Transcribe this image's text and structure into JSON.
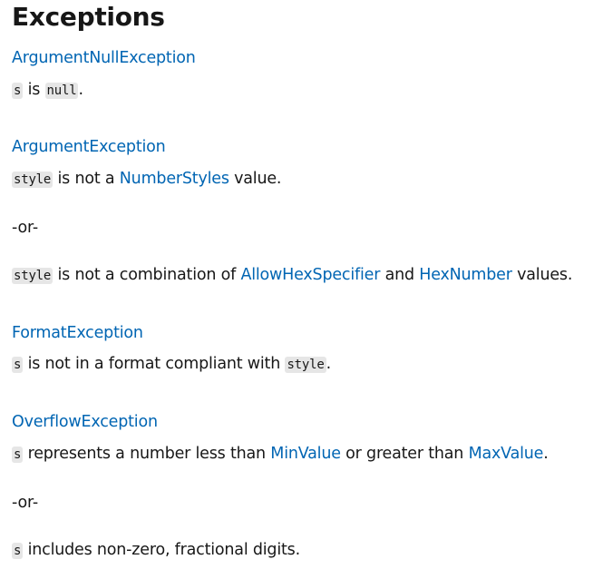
{
  "heading": "Exceptions",
  "entries": [
    {
      "exception": "ArgumentNullException",
      "paragraphs": [
        {
          "c1": "s",
          "t1": " is ",
          "c2": "null",
          "t2": "."
        }
      ]
    },
    {
      "exception": "ArgumentException",
      "paragraphs": [
        {
          "c1": "style",
          "t1": " is not a ",
          "l1": "NumberStyles",
          "t2": " value."
        },
        {
          "t1": "-or-"
        },
        {
          "c1": "style",
          "t1": " is not a combination of ",
          "l1": "AllowHexSpecifier",
          "t2": " and ",
          "l2": "HexNumber",
          "t3": " values."
        }
      ]
    },
    {
      "exception": "FormatException",
      "paragraphs": [
        {
          "c1": "s",
          "t1": " is not in a format compliant with ",
          "c2": "style",
          "t2": "."
        }
      ]
    },
    {
      "exception": "OverflowException",
      "paragraphs": [
        {
          "c1": "s",
          "t1": " represents a number less than ",
          "l1": "MinValue",
          "t2": " or greater than ",
          "l2": "MaxValue",
          "t3": "."
        },
        {
          "t1": "-or-"
        },
        {
          "c1": "s",
          "t1": " includes non-zero, fractional digits."
        }
      ]
    }
  ]
}
